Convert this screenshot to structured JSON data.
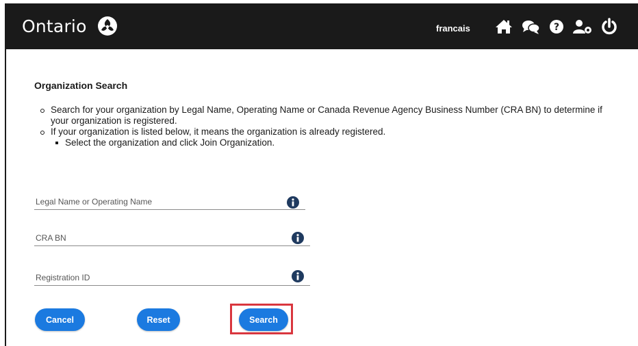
{
  "header": {
    "logo_text": "Ontario",
    "language_link": "francais",
    "icons": [
      "home-icon",
      "chat-icon",
      "help-icon",
      "user-settings-icon",
      "power-icon"
    ],
    "background_color": "#1a1a1a"
  },
  "main": {
    "title": "Organization Search",
    "bullets": [
      "Search for your organization by Legal Name, Operating Name or Canada Revenue Agency Business Number (CRA BN) to determine if your organization is registered.",
      "If your organization is listed below, it means the organization is already registered."
    ],
    "sub_bullet": "Select the organization and click Join Organization."
  },
  "form": {
    "legal_name": {
      "placeholder": "Legal Name or Operating Name",
      "value": ""
    },
    "cra_bn": {
      "placeholder": "CRA BN",
      "value": ""
    },
    "registration_id": {
      "placeholder": "Registration ID",
      "value": ""
    }
  },
  "buttons": {
    "cancel": "Cancel",
    "reset": "Reset",
    "search": "Search"
  },
  "colors": {
    "button": "#1b7ae0",
    "highlight": "#d9363e",
    "info_icon": "#1f3a5f"
  }
}
